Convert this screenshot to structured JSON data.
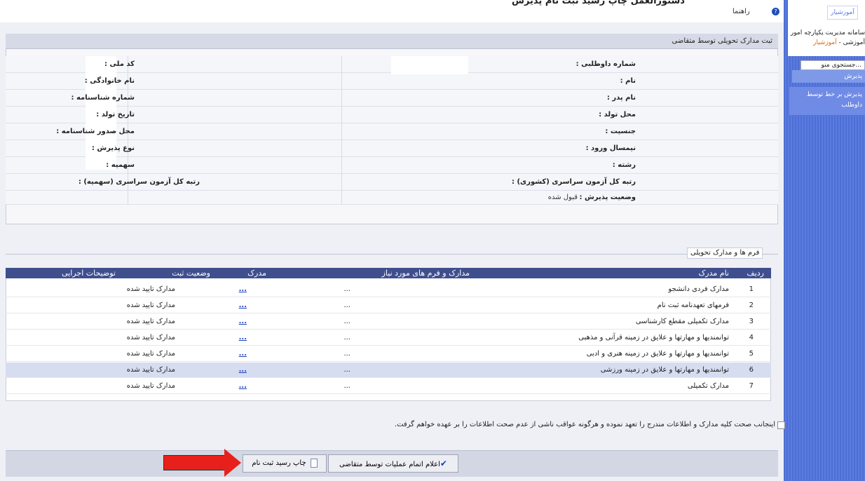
{
  "header": {
    "page_heading": "دستورالعمل چاپ رسید ثبت نام پذیرش",
    "help_label": "راهنما"
  },
  "sidebar": {
    "logo_text": "آموزشیار",
    "system_title_1": "سامانه مدیریت یکپارچه امور",
    "system_title_2a": "آموزشی - ",
    "system_title_2b": "آموزشیار",
    "search_placeholder": "جستجوی منو...",
    "section_label": "پذیرش",
    "item_label": "پذیرش بر خط توسط داوطلب"
  },
  "form": {
    "title": "ثبت مدارک تحویلی توسط متقاضی",
    "fields_right": [
      {
        "label": "شماره داوطلبی :"
      },
      {
        "label": "نام :"
      },
      {
        "label": "نام پدر :"
      },
      {
        "label": "محل تولد :"
      },
      {
        "label": "جنسیت :"
      },
      {
        "label": "نیمسال ورود :"
      },
      {
        "label": "رشته :"
      },
      {
        "label": "رتبه کل آزمون سراسری (کشوری) :"
      },
      {
        "label": "وضعیت پذیرش :",
        "value": "قبول شده"
      }
    ],
    "fields_left": [
      {
        "label": "کد ملی :"
      },
      {
        "label": "نام خانوادگی :"
      },
      {
        "label": "شماره شناسنامه :"
      },
      {
        "label": "تاریخ تولد :"
      },
      {
        "label": "محل صدور شناسنامه :"
      },
      {
        "label": "نوع پذیرش :"
      },
      {
        "label": "سهمیه :"
      },
      {
        "label": "رتبه کل آزمون سراسری (سهمیه) :"
      }
    ]
  },
  "docs": {
    "legend": "فرم ها و مدارک تحویلی",
    "columns": [
      "ردیف",
      "نام مدرک",
      "مدارک و فرم های مورد نیاز",
      "مدرک",
      "وضعیت ثبت",
      "توضیحات اجرایی"
    ],
    "rows": [
      {
        "num": "1",
        "name": "مدارک فردی دانشجو",
        "req": "...",
        "doc": "...",
        "status": "مدارک تایید شده"
      },
      {
        "num": "2",
        "name": "فرمهای تعهدنامه ثبت نام",
        "req": "...",
        "doc": "...",
        "status": "مدارک تایید شده"
      },
      {
        "num": "3",
        "name": "مدارک تکمیلی مقطع کارشناسی",
        "req": "...",
        "doc": "...",
        "status": "مدارک تایید شده"
      },
      {
        "num": "4",
        "name": "توانمندیها و مهارتها و علایق در زمینه قرآنی و مذهبی",
        "req": "...",
        "doc": "...",
        "status": "مدارک تایید شده"
      },
      {
        "num": "5",
        "name": "توانمندیها و مهارتها و علایق در زمینه هنری و ادبی",
        "req": "...",
        "doc": "...",
        "status": "مدارک تایید شده"
      },
      {
        "num": "6",
        "name": "توانمندیها و مهارتها و علایق در زمینه ورزشی",
        "req": "...",
        "doc": "...",
        "status": "مدارک تایید شده"
      },
      {
        "num": "7",
        "name": "مدارک تکمیلی",
        "req": "...",
        "doc": "...",
        "status": "مدارک تایید شده"
      }
    ]
  },
  "agreement": "اینجانب صحت کلیه مدارک و اطلاعات مندرج را تعهد نموده و هرگونه عواقب ناشی از عدم صحت اطلاعات را بر عهده خواهم گرفت.",
  "buttons": {
    "complete": "اعلام اتمام عملیات توسط متقاضی",
    "print": "چاپ رسید ثبت نام"
  },
  "colors": {
    "sidebar": "#5b7be0",
    "table_header": "#3f4f8e",
    "arrow": "#e8201b",
    "highlight_row": "#d7ddf0"
  }
}
